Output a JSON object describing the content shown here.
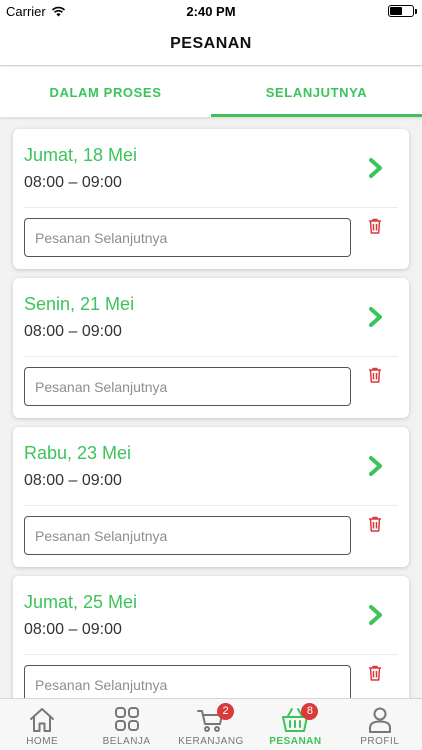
{
  "status_bar": {
    "carrier": "Carrier",
    "time": "2:40 PM"
  },
  "header": {
    "title": "PESANAN"
  },
  "tabs": [
    {
      "label": "DALAM PROSES",
      "active": false
    },
    {
      "label": "SELANJUTNYA",
      "active": true
    }
  ],
  "orders": [
    {
      "date": "Jumat, 18 Mei",
      "time": "08:00 – 09:00",
      "note_value": "",
      "note_placeholder": "Pesanan Selanjutnya"
    },
    {
      "date": "Senin, 21 Mei",
      "time": "08:00 – 09:00",
      "note_value": "",
      "note_placeholder": "Pesanan Selanjutnya"
    },
    {
      "date": "Rabu, 23 Mei",
      "time": "08:00 – 09:00",
      "note_value": "",
      "note_placeholder": "Pesanan Selanjutnya"
    },
    {
      "date": "Jumat, 25 Mei",
      "time": "08:00 – 09:00",
      "note_value": "",
      "note_placeholder": "Pesanan Selanjutnya"
    }
  ],
  "bottom_nav": [
    {
      "label": "HOME",
      "icon": "home-icon"
    },
    {
      "label": "BELANJA",
      "icon": "grid-icon"
    },
    {
      "label": "KERANJANG",
      "icon": "cart-icon",
      "badge": "2"
    },
    {
      "label": "PESANAN",
      "icon": "basket-icon",
      "badge": "8",
      "active": true
    },
    {
      "label": "PROFIL",
      "icon": "user-icon"
    }
  ],
  "colors": {
    "accent": "#3cc45a",
    "delete": "#d93a3a",
    "badge": "#d93a3a"
  }
}
